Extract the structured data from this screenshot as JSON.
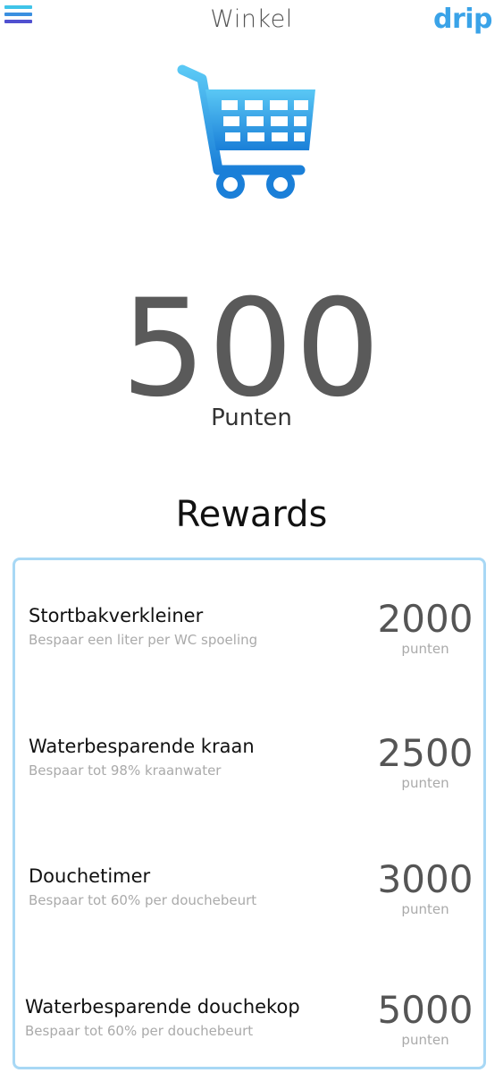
{
  "header": {
    "title": "Winkel",
    "brand": "drip",
    "menu_icon": "hamburger-menu-icon",
    "menu_colors": [
      "#40c4e8",
      "#3a8fe0",
      "#5050d0"
    ]
  },
  "hero": {
    "icon": "shopping-cart-icon",
    "points": "500",
    "points_label": "Punten"
  },
  "rewards": {
    "heading": "Rewards",
    "items": [
      {
        "name": "Stortbakverkleiner",
        "description": "Bespaar een liter per WC spoeling",
        "cost": "2000",
        "unit": "punten"
      },
      {
        "name": "Waterbesparende kraan",
        "description": "Bespaar tot 98% kraanwater",
        "cost": "2500",
        "unit": "punten"
      },
      {
        "name": "Douchetimer",
        "description": "Bespaar tot 60% per douchebeurt",
        "cost": "3000",
        "unit": "punten"
      },
      {
        "name": "Waterbesparende douchekop",
        "description": "Bespaar tot 60% per douchebeurt",
        "cost": "5000",
        "unit": "punten"
      }
    ]
  },
  "colors": {
    "accent": "#3aa3e8",
    "box_border": "#a8d8f5",
    "cart_light": "#5ac8f5",
    "cart_dark": "#1a7fd8"
  }
}
